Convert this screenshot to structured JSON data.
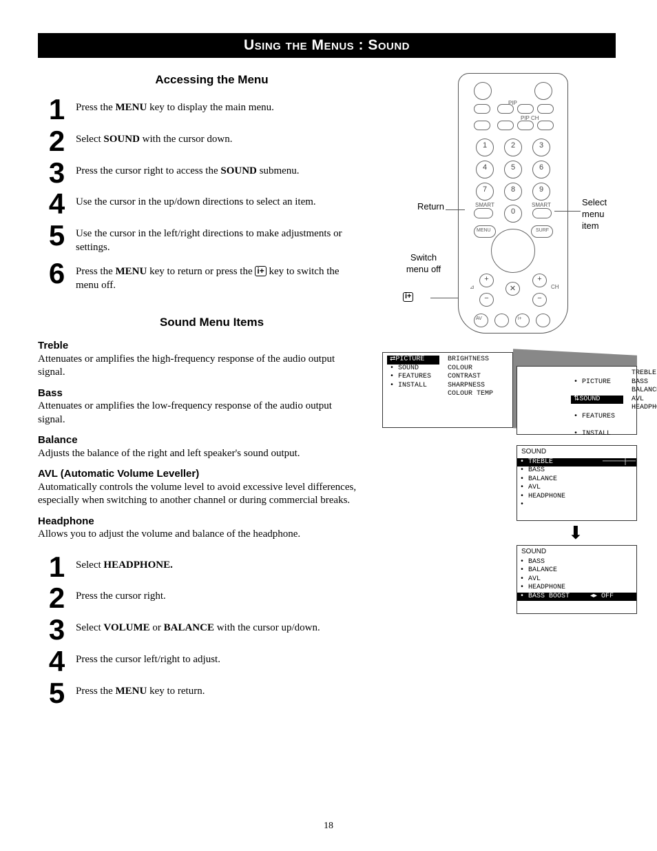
{
  "title": "Using the Menus : Sound",
  "access_heading": "Accessing the Menu",
  "items_heading": "Sound Menu Items",
  "page_number": "18",
  "steps_a": [
    {
      "n": "1",
      "html": "Press the <b>MENU</b> key to display the main menu."
    },
    {
      "n": "2",
      "html": "Select <b>SOUND</b> with the cursor down."
    },
    {
      "n": "3",
      "html": "Press the cursor right to access the <b>SOUND</b> submenu."
    },
    {
      "n": "4",
      "html": "Use the cursor in the up/down directions to select an item."
    },
    {
      "n": "5",
      "html": "Use the cursor in the left/right directions to make adjustments or settings."
    },
    {
      "n": "6",
      "html": "Press the <b>MENU</b> key to return or press the <span class='info-icon'>i+</span> key to switch the menu off."
    }
  ],
  "defs": [
    {
      "t": "Treble",
      "d": "Attenuates or amplifies the high-frequency response of the audio output signal."
    },
    {
      "t": "Bass",
      "d": "Attenuates or amplifies the low-frequency response of the audio output signal."
    },
    {
      "t": "Balance",
      "d": "Adjusts the balance of the right and left speaker's sound output."
    },
    {
      "t": "AVL (Automatic Volume Leveller)",
      "d": "Automatically controls the volume level to avoid excessive level differences, especially when switching to another channel or during commercial breaks."
    },
    {
      "t": "Headphone",
      "d": "Allows you to adjust the volume and balance of the headphone."
    }
  ],
  "steps_b": [
    {
      "n": "1",
      "html": "Select <b>HEADPHONE.</b>"
    },
    {
      "n": "2",
      "html": "Press the cursor right."
    },
    {
      "n": "3",
      "html": "Select <b>VOLUME</b> or <b>BALANCE</b> with the cursor up/down."
    },
    {
      "n": "4",
      "html": "Press the cursor left/right to adjust."
    },
    {
      "n": "5",
      "html": "Press the <b>MENU</b> key to return."
    }
  ],
  "callouts": {
    "return": "Return",
    "switch": "Switch menu off",
    "select": "Select menu item"
  },
  "osd": {
    "panel1": {
      "left": [
        "⇄PICTURE",
        "• SOUND",
        "• FEATURES",
        "• INSTALL"
      ],
      "right": [
        "BRIGHTNESS",
        "COLOUR",
        "CONTRAST",
        "SHARPNESS",
        "COLOUR TEMP"
      ]
    },
    "panel2": {
      "left0": "• PICTURE",
      "leftH": "⇅SOUND",
      "left2": "• FEATURES",
      "left3": "• INSTALL",
      "right": [
        "TREBLE",
        "BASS",
        "BALANCE",
        "AVL",
        "HEADPHONE"
      ]
    },
    "panel3": {
      "title": "SOUND",
      "rowH": "• TREBLE            ─────┼── ▸ 59",
      "rows": [
        "• BASS",
        "• BALANCE",
        "• AVL",
        "• HEADPHONE",
        "•"
      ]
    },
    "panel4": {
      "title": "SOUND",
      "rows": [
        "• BASS",
        "• BALANCE",
        "• AVL",
        "• HEADPHONE"
      ],
      "rowH": "• BASS BOOST     ◂▸ OFF"
    }
  }
}
